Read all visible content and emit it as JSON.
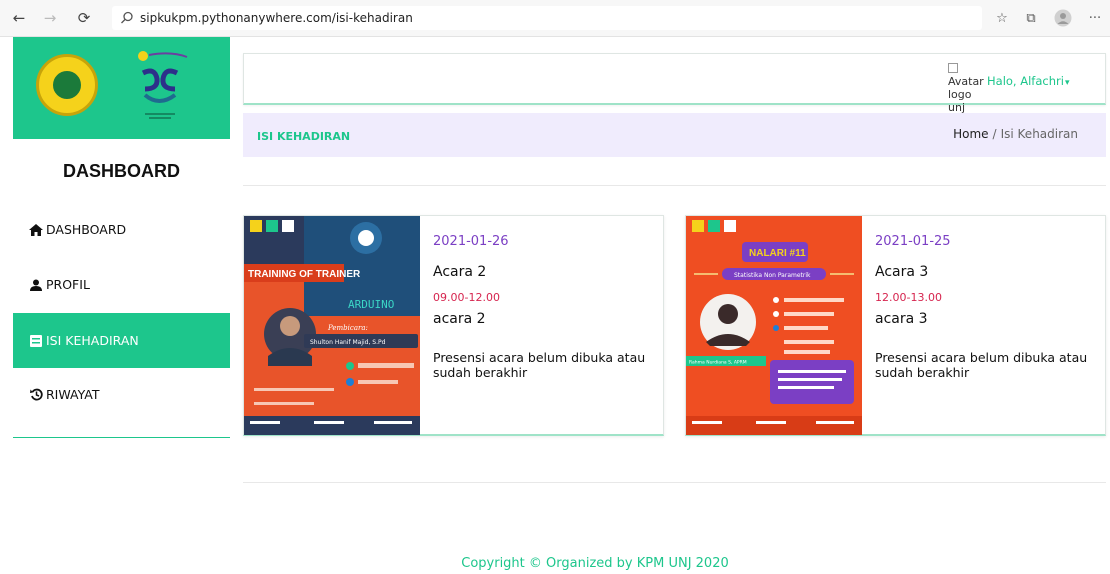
{
  "browser": {
    "url": "sipkukpm.pythonanywhere.com/isi-kehadiran",
    "back_glyph": "←",
    "forward_glyph": "→",
    "refresh_glyph": "⟳",
    "favorites_glyph": "☆",
    "collections_glyph": "⧉",
    "more_glyph": "···"
  },
  "sidebar": {
    "title": "DASHBOARD",
    "items": [
      {
        "label": "DASHBOARD",
        "icon": "home-icon"
      },
      {
        "label": "PROFIL",
        "icon": "user-icon"
      },
      {
        "label": "ISI KEHADIRAN",
        "icon": "form-icon",
        "active": true
      },
      {
        "label": "RIWAYAT",
        "icon": "history-icon"
      }
    ]
  },
  "topbar": {
    "avatar_alt": "Avatar logo unj",
    "greeting": "Halo, Alfachri"
  },
  "page_header": {
    "title": "ISI KEHADIRAN",
    "breadcrumb_home": "Home",
    "breadcrumb_sep": "/",
    "breadcrumb_current": "Isi Kehadiran"
  },
  "events": [
    {
      "date": "2021-01-26",
      "name": "Acara 2",
      "time": "09.00-12.00",
      "description": "acara 2",
      "status": "Presensi acara belum dibuka atau sudah berakhir",
      "poster": {
        "title": "TRAINING OF TRAINER",
        "subtitle": "ARDUINO",
        "presenter_label": "Pembicara:",
        "presenter": "Shulton Hanif Majid, S.Pd",
        "bg": "#e8542a"
      }
    },
    {
      "date": "2021-01-25",
      "name": "Acara 3",
      "time": "12.00-13.00",
      "description": "acara 3",
      "status": "Presensi acara belum dibuka atau sudah berakhir",
      "poster": {
        "title": "NALARI #11",
        "subtitle": "Statistika Non Parametrik",
        "presenter": "Rahma Nurdiana S, APRM",
        "bg": "#ef4e22"
      }
    }
  ],
  "footer": {
    "text": "Copyright © Organized by KPM UNJ 2020"
  },
  "colors": {
    "accent": "#1dc68c",
    "date": "#7b3fc4",
    "time": "#d6254f",
    "header_bg": "#f0ecfd"
  }
}
